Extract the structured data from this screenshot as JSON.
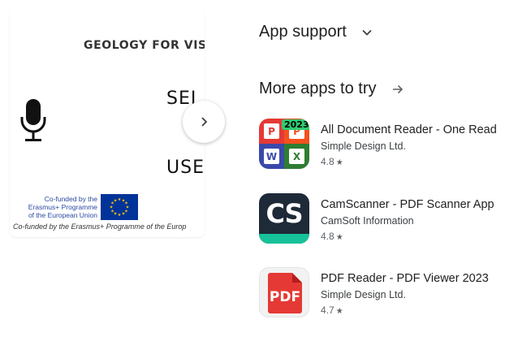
{
  "screenshot": {
    "title": "GEOLOGY FOR VISU",
    "word_1": "SEI",
    "word_2": "USE",
    "eu_lines": [
      "Co-funded by the",
      "Erasmus+ Programme",
      "of the European Union"
    ],
    "footer": "Co-funded by the Erasmus+ Programme of the Europ",
    "next_icon": "chevron-right-icon"
  },
  "app_support": {
    "label": "App support",
    "icon": "chevron-down-icon"
  },
  "more_apps": {
    "label": "More apps to try",
    "icon": "arrow-right-icon"
  },
  "apps": [
    {
      "name": "All Document Reader - One Read",
      "developer": "Simple Design Ltd.",
      "rating": "4.8",
      "badge": "2023"
    },
    {
      "name": "CamScanner - PDF Scanner App",
      "developer": "CamSoft Information",
      "rating": "4.8",
      "icon_text": "CS"
    },
    {
      "name": "PDF Reader - PDF Viewer 2023",
      "developer": "Simple Design Ltd.",
      "rating": "4.7",
      "icon_text": "PDF"
    }
  ],
  "colors": {
    "text": "#202124",
    "secondary": "#5f6368",
    "cs_teal": "#17c29a",
    "pdf_red": "#e53935"
  }
}
